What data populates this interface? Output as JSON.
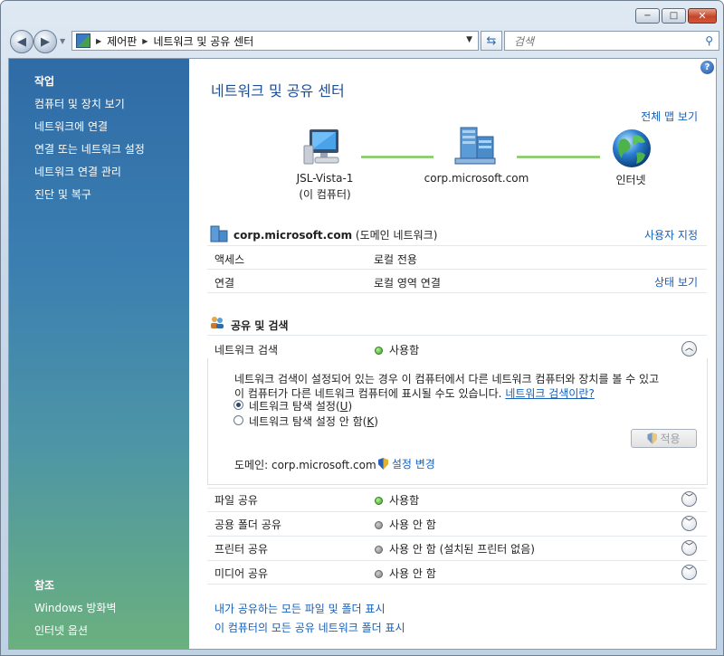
{
  "window": {
    "min_glyph": "−",
    "max_glyph": "□",
    "close_glyph": "✕"
  },
  "nav": {
    "breadcrumb": [
      "제어판",
      "네트워크 및 공유 센터"
    ],
    "search_placeholder": "검색"
  },
  "sidebar": {
    "tasks_heading": "작업",
    "tasks": [
      "컴퓨터 및 장치 보기",
      "네트워크에 연결",
      "연결 또는 네트워크 설정",
      "네트워크 연결 관리",
      "진단 및 복구"
    ],
    "see_also_heading": "참조",
    "see_also": [
      "Windows 방화벽",
      "인터넷 옵션"
    ]
  },
  "main": {
    "title": "네트워크 및 공유 센터",
    "view_full_map": "전체 맵 보기",
    "map": {
      "computer_name": "JSL-Vista-1",
      "computer_sub": "(이 컴퓨터)",
      "domain_node": "corp.microsoft.com",
      "internet_node": "인터넷"
    },
    "network": {
      "name": "corp.microsoft.com",
      "type": "(도메인 네트워크)",
      "customize": "사용자 지정",
      "rows": [
        {
          "label": "액세스",
          "value": "로컬 전용",
          "action": ""
        },
        {
          "label": "연결",
          "value": "로컬 영역 연결",
          "action": "상태 보기"
        }
      ]
    },
    "sharing": {
      "heading": "공유 및 검색",
      "discovery": {
        "label": "네트워크 검색",
        "status": "사용함",
        "desc_line1": "네트워크 검색이 설정되어 있는 경우 이 컴퓨터에서 다른 네트워크 컴퓨터와 장치를 볼 수 있고",
        "desc_line2": "이 컴퓨터가 다른 네트워크 컴퓨터에 표시될 수도 있습니다.",
        "desc_link": "네트워크 검색이란?",
        "option_on_text": "네트워크 탐색 설정(",
        "option_on_key": "U",
        "option_off_text": "네트워크 탐색 설정 안 함(",
        "option_off_key": "K",
        "paren_close": ")",
        "apply": "적용",
        "domain_label": "도메인: corp.microsoft.com",
        "change_settings": "설정 변경"
      },
      "items": [
        {
          "label": "파일 공유",
          "status": "사용함",
          "on": true
        },
        {
          "label": "공용 폴더 공유",
          "status": "사용 안 함",
          "on": false
        },
        {
          "label": "프린터 공유",
          "status": "사용 안 함 (설치된 프린터 없음)",
          "on": false
        },
        {
          "label": "미디어 공유",
          "status": "사용 안 함",
          "on": false
        }
      ]
    },
    "bottom_links": [
      "내가 공유하는 모든 파일 및 폴더 표시",
      "이 컴퓨터의 모든 공유 네트워크 폴더 표시"
    ]
  }
}
